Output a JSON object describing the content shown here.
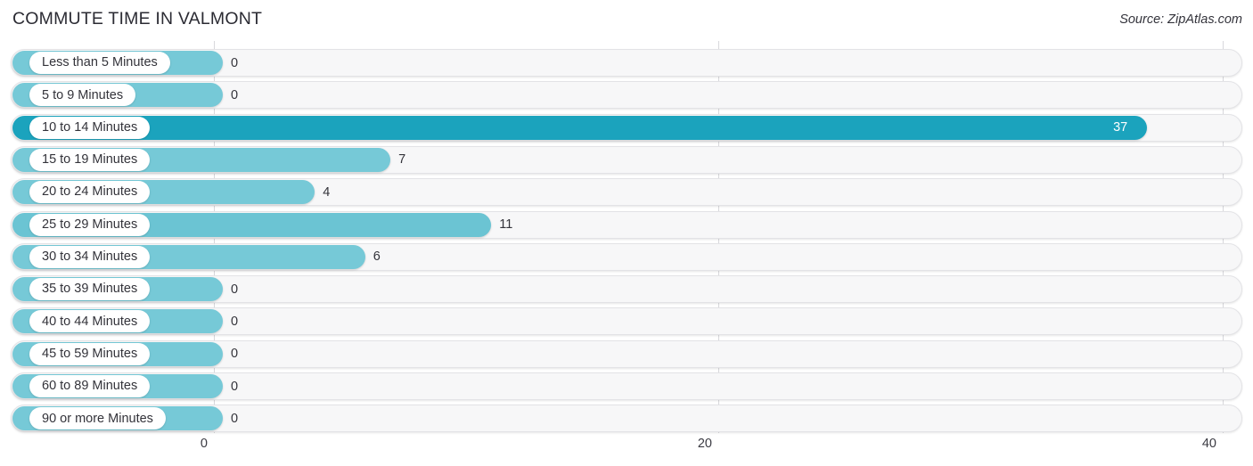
{
  "header": {
    "title": "COMMUTE TIME IN VALMONT",
    "source": "Source: ZipAtlas.com"
  },
  "colors": {
    "bar": "#76c9d7",
    "bar_highlight": "#1ba3bd",
    "bar_mid": "#6bc4d3",
    "track": "#f7f7f8",
    "gridline": "#d8d8dc",
    "text": "#33333a"
  },
  "chart_data": {
    "type": "bar",
    "orientation": "horizontal",
    "title": "COMMUTE TIME IN VALMONT",
    "xlabel": "",
    "ylabel": "",
    "xlim": [
      0,
      40
    ],
    "grid": true,
    "legend": null,
    "ticks": [
      "0",
      "20",
      "40"
    ],
    "tick_values": [
      0,
      20,
      40
    ],
    "categories": [
      "Less than 5 Minutes",
      "5 to 9 Minutes",
      "10 to 14 Minutes",
      "15 to 19 Minutes",
      "20 to 24 Minutes",
      "25 to 29 Minutes",
      "30 to 34 Minutes",
      "35 to 39 Minutes",
      "40 to 44 Minutes",
      "45 to 59 Minutes",
      "60 to 89 Minutes",
      "90 or more Minutes"
    ],
    "values": [
      0,
      0,
      37,
      7,
      4,
      11,
      6,
      0,
      0,
      0,
      0,
      0
    ],
    "value_labels": [
      "0",
      "0",
      "37",
      "7",
      "4",
      "11",
      "6",
      "0",
      "0",
      "0",
      "0",
      "0"
    ]
  },
  "rows": [
    {
      "label": "Less than 5 Minutes",
      "value": 0,
      "value_label": "0",
      "style": "normal",
      "inside": false
    },
    {
      "label": "5 to 9 Minutes",
      "value": 0,
      "value_label": "0",
      "style": "normal",
      "inside": false
    },
    {
      "label": "10 to 14 Minutes",
      "value": 37,
      "value_label": "37",
      "style": "highlight",
      "inside": true
    },
    {
      "label": "15 to 19 Minutes",
      "value": 7,
      "value_label": "7",
      "style": "normal",
      "inside": false
    },
    {
      "label": "20 to 24 Minutes",
      "value": 4,
      "value_label": "4",
      "style": "normal",
      "inside": false
    },
    {
      "label": "25 to 29 Minutes",
      "value": 11,
      "value_label": "11",
      "style": "mid",
      "inside": false
    },
    {
      "label": "30 to 34 Minutes",
      "value": 6,
      "value_label": "6",
      "style": "normal",
      "inside": false
    },
    {
      "label": "35 to 39 Minutes",
      "value": 0,
      "value_label": "0",
      "style": "normal",
      "inside": false
    },
    {
      "label": "40 to 44 Minutes",
      "value": 0,
      "value_label": "0",
      "style": "normal",
      "inside": false
    },
    {
      "label": "45 to 59 Minutes",
      "value": 0,
      "value_label": "0",
      "style": "normal",
      "inside": false
    },
    {
      "label": "60 to 89 Minutes",
      "value": 0,
      "value_label": "0",
      "style": "normal",
      "inside": false
    },
    {
      "label": "90 or more Minutes",
      "value": 0,
      "value_label": "0",
      "style": "normal",
      "inside": false
    }
  ]
}
